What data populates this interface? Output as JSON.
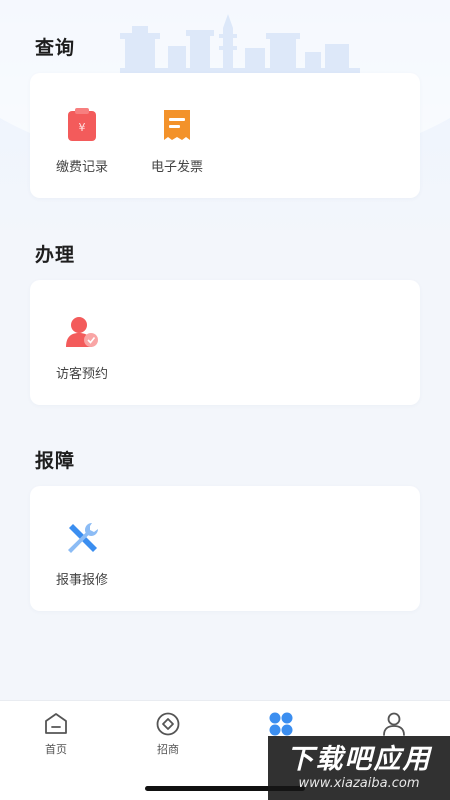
{
  "sections": [
    {
      "title": "查询",
      "items": [
        {
          "label": "缴费记录",
          "icon": "payment-record-icon",
          "color": "#f35b5b"
        },
        {
          "label": "电子发票",
          "icon": "e-invoice-icon",
          "color": "#f3922a"
        }
      ]
    },
    {
      "title": "办理",
      "items": [
        {
          "label": "访客预约",
          "icon": "visitor-appointment-icon",
          "color": "#f35b5b"
        }
      ]
    },
    {
      "title": "报障",
      "items": [
        {
          "label": "报事报修",
          "icon": "repair-tools-icon",
          "color": "#3b8ef0"
        }
      ]
    }
  ],
  "tabbar": {
    "items": [
      {
        "label": "首页",
        "icon": "home-icon",
        "active": false
      },
      {
        "label": "招商",
        "icon": "investment-icon",
        "active": false
      },
      {
        "label": "",
        "icon": "services-grid-icon",
        "active": true
      },
      {
        "label": "",
        "icon": "profile-icon",
        "active": false
      }
    ]
  },
  "watermark": {
    "main": "下载吧应用",
    "url": "www.xiazaiba.com"
  },
  "colors": {
    "accent": "#3b8ef0",
    "background": "#f3f6fb",
    "card": "#ffffff"
  }
}
